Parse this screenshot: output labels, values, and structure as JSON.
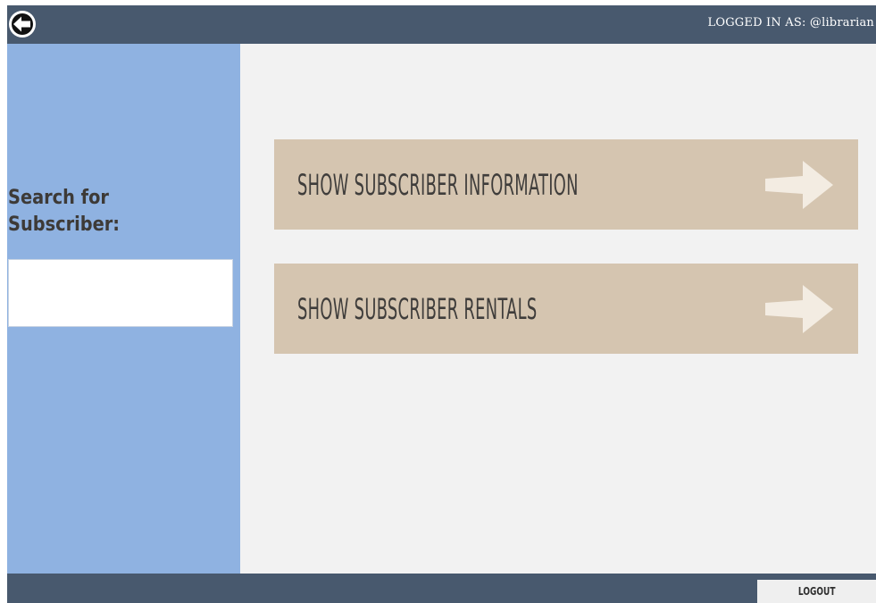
{
  "header": {
    "back_icon": "back-arrow-circle-icon",
    "logged_in_prefix": "LOGGED IN AS:",
    "username": "@librarian"
  },
  "sidebar": {
    "search_label": "Search for Subscriber:",
    "search_value": "",
    "search_placeholder": ""
  },
  "main": {
    "actions": [
      {
        "label": "SHOW SUBSCRIBER INFORMATION",
        "icon": "arrow-right-icon"
      },
      {
        "label": "SHOW SUBSCRIBER RENTALS",
        "icon": "arrow-right-icon"
      }
    ]
  },
  "footer": {
    "logout_label": "LOGOUT"
  },
  "colors": {
    "bar": "#48596e",
    "sidebar": "#8fb2e1",
    "content_bg": "#f2f2f2",
    "action_button": "#d5c5b0",
    "arrow": "#f3ece2"
  }
}
